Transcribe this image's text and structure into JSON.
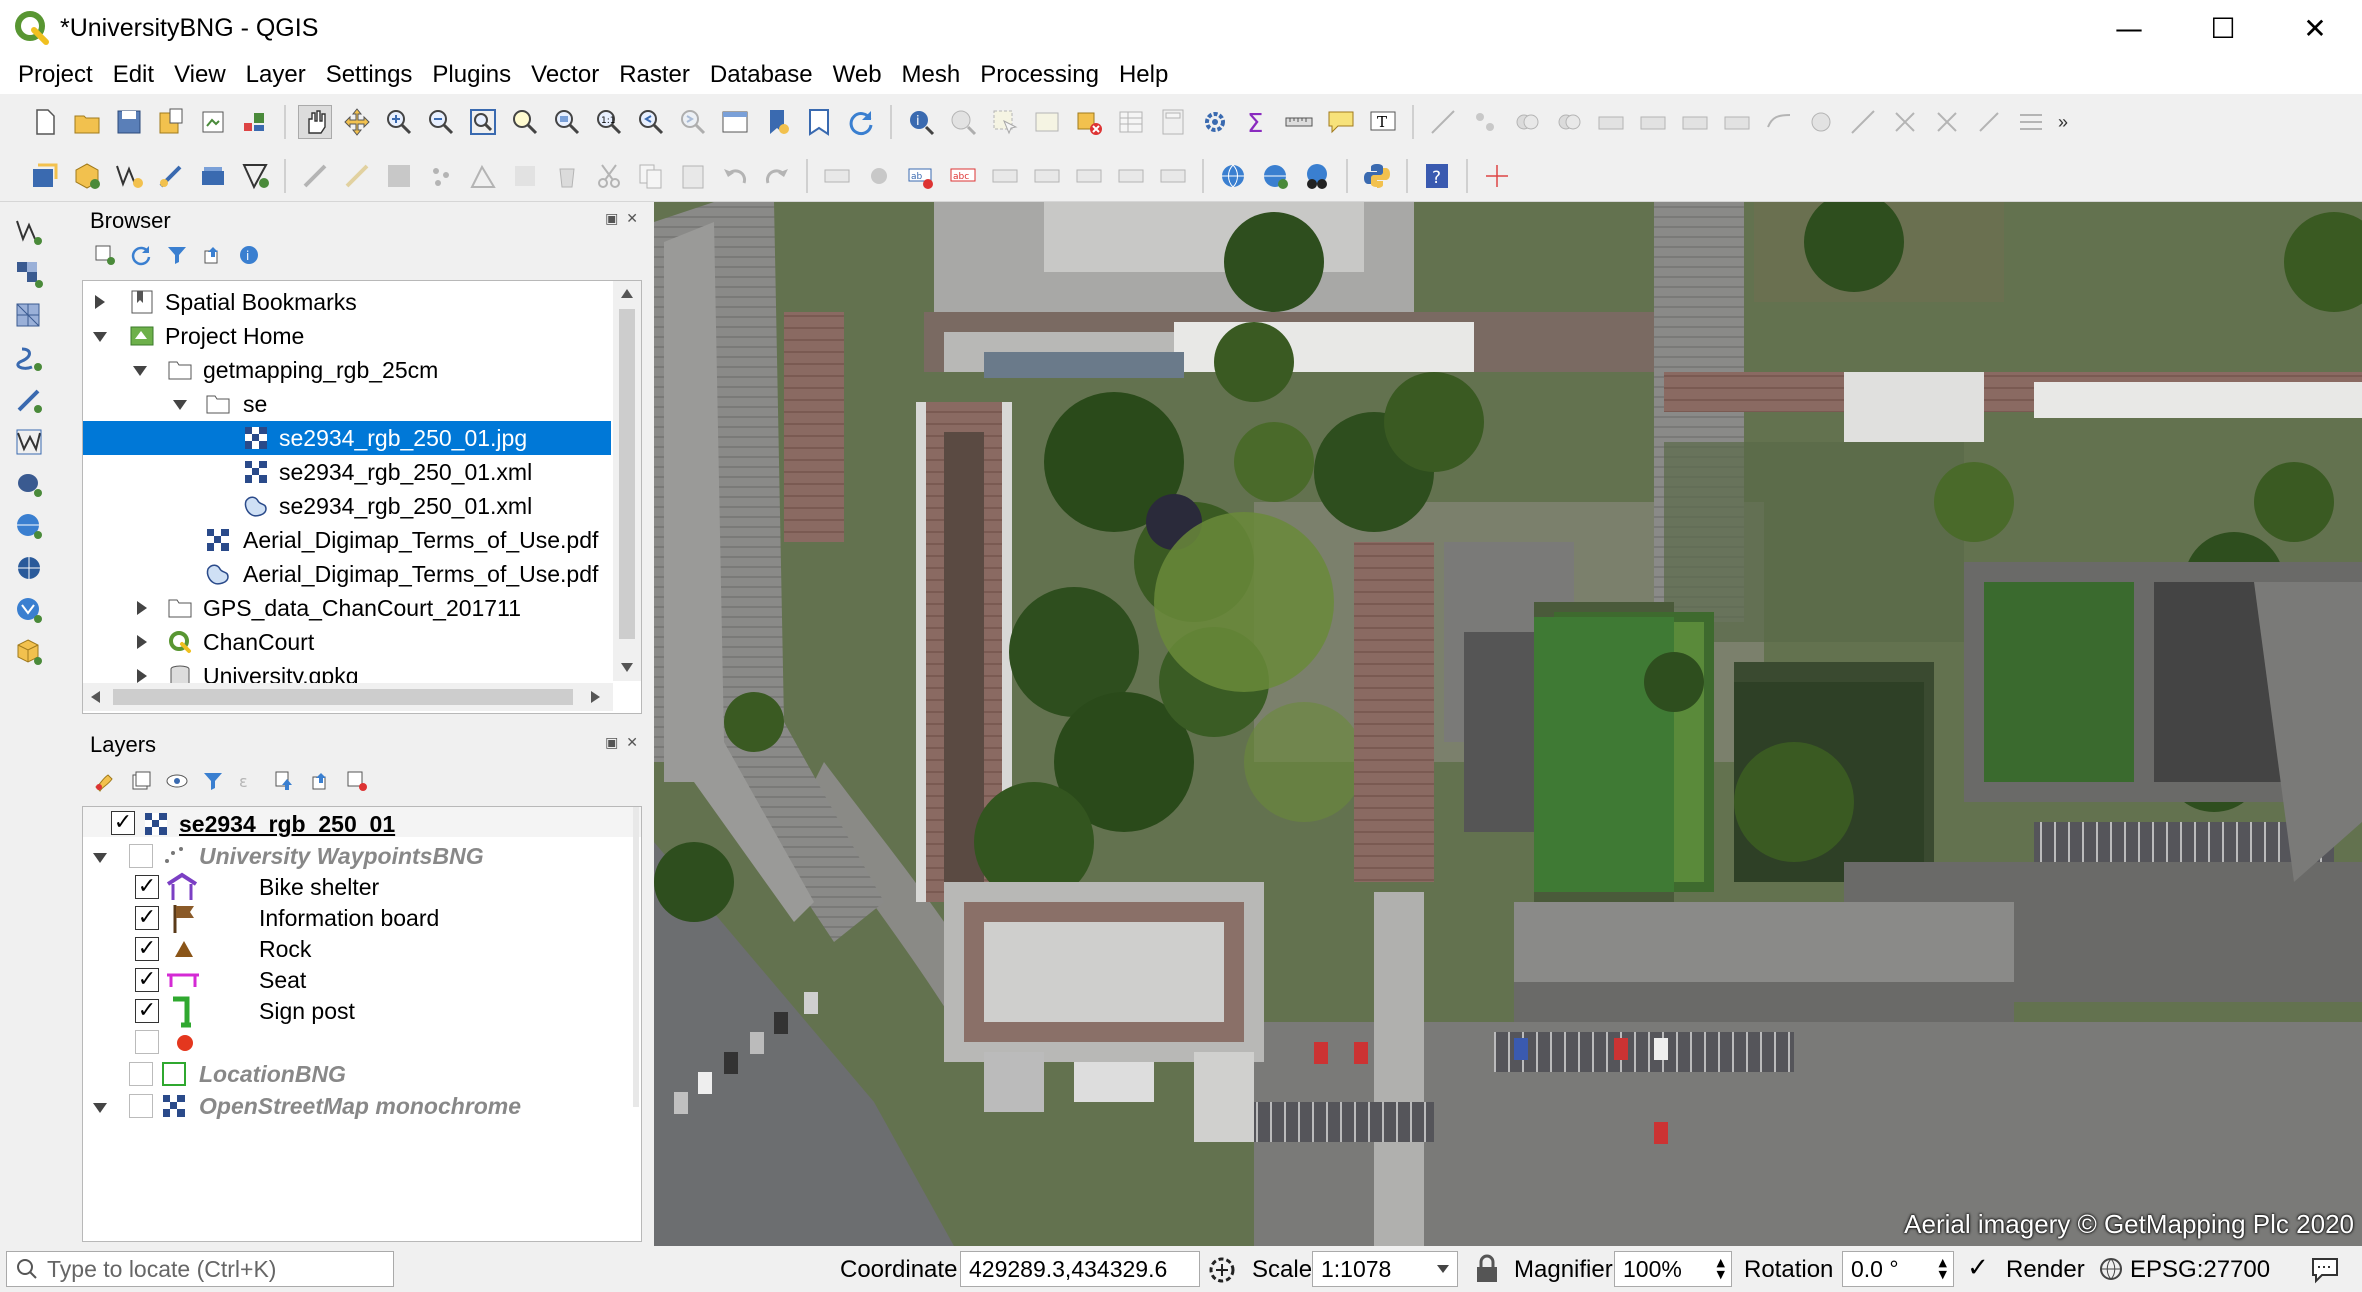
{
  "window": {
    "title": "*UniversityBNG - QGIS",
    "minimize": "—",
    "maximize": "☐",
    "close": "✕"
  },
  "menu": [
    "Project",
    "Edit",
    "View",
    "Layer",
    "Settings",
    "Plugins",
    "Vector",
    "Raster",
    "Database",
    "Web",
    "Mesh",
    "Processing",
    "Help"
  ],
  "browser": {
    "title": "Browser",
    "items": [
      {
        "label": "Spatial Bookmarks",
        "icon": "bookmark-icon"
      },
      {
        "label": "Project Home",
        "icon": "project-home-icon"
      },
      {
        "label": "getmapping_rgb_25cm",
        "icon": "folder-icon"
      },
      {
        "label": "se",
        "icon": "folder-icon"
      },
      {
        "label": "se2934_rgb_250_01.jpg",
        "icon": "raster-icon",
        "selected": true
      },
      {
        "label": "se2934_rgb_250_01.xml",
        "icon": "raster-icon"
      },
      {
        "label": "se2934_rgb_250_01.xml",
        "icon": "vector-icon"
      },
      {
        "label": "Aerial_Digimap_Terms_of_Use.pdf",
        "icon": "raster-icon"
      },
      {
        "label": "Aerial_Digimap_Terms_of_Use.pdf",
        "icon": "vector-icon"
      },
      {
        "label": "GPS_data_ChanCourt_201711",
        "icon": "folder-icon"
      },
      {
        "label": "ChanCourt",
        "icon": "qgis-project-icon"
      },
      {
        "label": "University.gpkg",
        "icon": "geopackage-icon"
      }
    ]
  },
  "layers": {
    "title": "Layers",
    "items": [
      {
        "label": "se2934_rgb_250_01",
        "checked": true
      },
      {
        "label": "University WaypointsBNG",
        "checked": false
      },
      {
        "label": "Bike shelter",
        "checked": true
      },
      {
        "label": "Information board",
        "checked": true
      },
      {
        "label": "Rock",
        "checked": true
      },
      {
        "label": "Seat",
        "checked": true
      },
      {
        "label": "Sign post",
        "checked": true
      },
      {
        "label": "",
        "checked": false
      },
      {
        "label": "LocationBNG",
        "checked": false
      },
      {
        "label": "OpenStreetMap monochrome",
        "checked": false
      }
    ]
  },
  "map": {
    "attribution": "Aerial imagery © GetMapping Plc 2020"
  },
  "status": {
    "locator_placeholder": "Type to locate (Ctrl+K)",
    "coordinate_label": "Coordinate",
    "coordinate_value": "429289.3,434329.6",
    "scale_label": "Scale",
    "scale_value": "1:1078",
    "magnifier_label": "Magnifier",
    "magnifier_value": "100%",
    "rotation_label": "Rotation",
    "rotation_value": "0.0 °",
    "render_label": "Render",
    "crs": "EPSG:27700"
  },
  "colors": {
    "accent": "#0078d7",
    "qgis_green": "#589632",
    "qgis_yellow": "#ee7913"
  }
}
